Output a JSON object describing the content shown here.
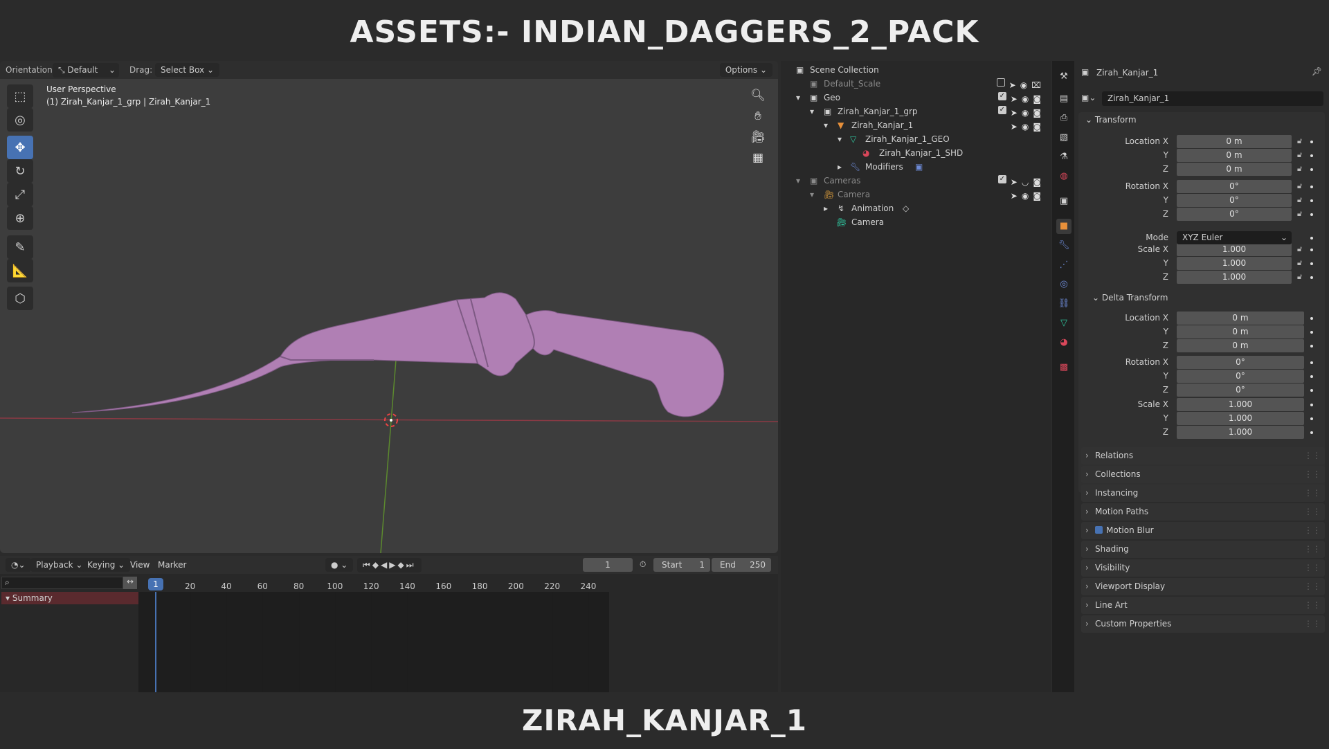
{
  "title": "ASSETS:- INDIAN_DAGGERS_2_PACK",
  "footer": "ZIRAH_KANJAR_1",
  "viewport": {
    "orientation_label": "Orientation:",
    "orientation_value": "Default",
    "drag_label": "Drag:",
    "drag_value": "Select Box",
    "options": "Options",
    "view_name": "User Perspective",
    "object_info": "(1) Zirah_Kanjar_1_grp | Zirah_Kanjar_1",
    "object_color": "#b07fb4"
  },
  "outliner": {
    "rows": [
      {
        "label": "Scene Collection"
      },
      {
        "label": "Default_Scale"
      },
      {
        "label": "Geo"
      },
      {
        "label": "Zirah_Kanjar_1_grp"
      },
      {
        "label": "Zirah_Kanjar_1"
      },
      {
        "label": "Zirah_Kanjar_1_GEO"
      },
      {
        "label": "Zirah_Kanjar_1_SHD"
      },
      {
        "label": "Modifiers"
      },
      {
        "label": "Cameras"
      },
      {
        "label": "Camera"
      },
      {
        "label": "Animation"
      },
      {
        "label": "Camera"
      }
    ]
  },
  "properties": {
    "object_name": "Zirah_Kanjar_1",
    "name_field": "Zirah_Kanjar_1",
    "transform": "Transform",
    "location_label": "Location X",
    "rotation_label": "Rotation X",
    "scale_label": "Scale X",
    "y": "Y",
    "z": "Z",
    "mode_label": "Mode",
    "mode_value": "XYZ Euler",
    "loc": [
      "0 m",
      "0 m",
      "0 m"
    ],
    "rot": [
      "0°",
      "0°",
      "0°"
    ],
    "scale": [
      "1.000",
      "1.000",
      "1.000"
    ],
    "delta": "Delta Transform",
    "dloc": [
      "0 m",
      "0 m",
      "0 m"
    ],
    "drot": [
      "0°",
      "0°",
      "0°"
    ],
    "dscale": [
      "1.000",
      "1.000",
      "1.000"
    ],
    "panels": [
      "Relations",
      "Collections",
      "Instancing",
      "Motion Paths",
      "Motion Blur",
      "Shading",
      "Visibility",
      "Viewport Display",
      "Line Art",
      "Custom Properties"
    ]
  },
  "timeline": {
    "menus": [
      "Playback",
      "Keying",
      "View",
      "Marker"
    ],
    "current_frame": "1",
    "start_label": "Start",
    "start": "1",
    "end_label": "End",
    "end": "250",
    "summary": "Summary",
    "ticks": [
      "1",
      "20",
      "40",
      "60",
      "80",
      "100",
      "120",
      "140",
      "160",
      "180",
      "200",
      "220",
      "240"
    ]
  }
}
